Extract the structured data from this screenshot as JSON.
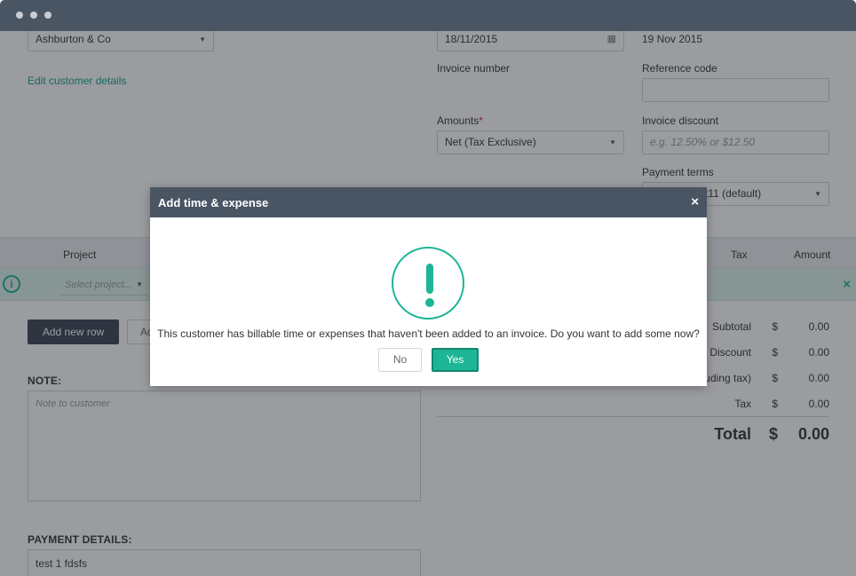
{
  "window": {
    "controls": [
      "close",
      "minimize",
      "maximize"
    ]
  },
  "form": {
    "customer_value": "Ashburton & Co",
    "edit_customer_link": "Edit customer details",
    "date_value": "18/11/2015",
    "due_date_text": "19 Nov 2015",
    "invoice_number_label": "Invoice number",
    "reference_code_label": "Reference code",
    "amounts_label": "Amounts",
    "amounts_required": "*",
    "amounts_value": "Net (Tax Exclusive)",
    "invoice_discount_label": "Invoice discount",
    "invoice_discount_placeholder": "e.g. 12.50% or $12.50",
    "payment_terms_label": "Payment terms",
    "payment_terms_value": "t11 (default)"
  },
  "table": {
    "columns": {
      "project": "Project",
      "tax": "Tax",
      "amount": "Amount"
    },
    "project_placeholder": "Select project...",
    "add_row_button": "Add new row",
    "second_button_partial": "Ad"
  },
  "note": {
    "title": "NOTE:",
    "placeholder": "Note to customer"
  },
  "payment_details": {
    "title": "PAYMENT DETAILS:",
    "value": "test 1 fdsfs"
  },
  "totals": {
    "rows": [
      {
        "label": "Subtotal",
        "currency": "$",
        "value": "0.00"
      },
      {
        "label": "Discount",
        "currency": "$",
        "value": "0.00"
      },
      {
        "label": "luding tax)",
        "currency": "$",
        "value": "0.00"
      },
      {
        "label": "Tax",
        "currency": "$",
        "value": "0.00"
      }
    ],
    "total_label": "Total",
    "total_currency": "$",
    "total_value": "0.00"
  },
  "modal": {
    "title": "Add time & expense",
    "close_glyph": "×",
    "alert_glyph": "!",
    "message": "This customer has billable time or expenses that haven't been added to an invoice. Do you want to add some now?",
    "no_label": "No",
    "yes_label": "Yes"
  },
  "colors": {
    "accent": "#1db595",
    "header": "#4a5563",
    "dark_button": "#3b4350"
  }
}
